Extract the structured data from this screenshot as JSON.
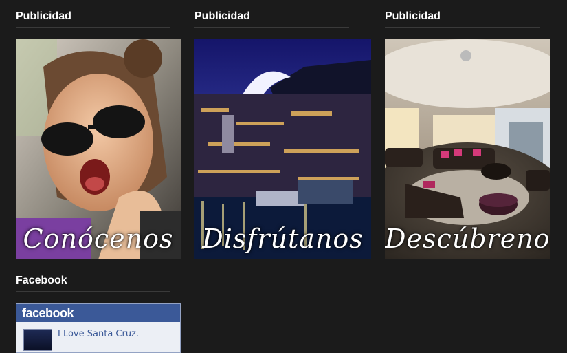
{
  "widgets": [
    {
      "title": "Publicidad",
      "caption": "Conócenos"
    },
    {
      "title": "Publicidad",
      "caption": "Disfrútanos"
    },
    {
      "title": "Publicidad",
      "caption": "Descúbrenos"
    }
  ],
  "facebook": {
    "title": "Facebook",
    "brand": "facebook",
    "page_name": "I Love Santa Cruz."
  },
  "colors": {
    "background": "#1b1b1b",
    "title_text": "#ffffff",
    "facebook_blue": "#3b5998"
  }
}
